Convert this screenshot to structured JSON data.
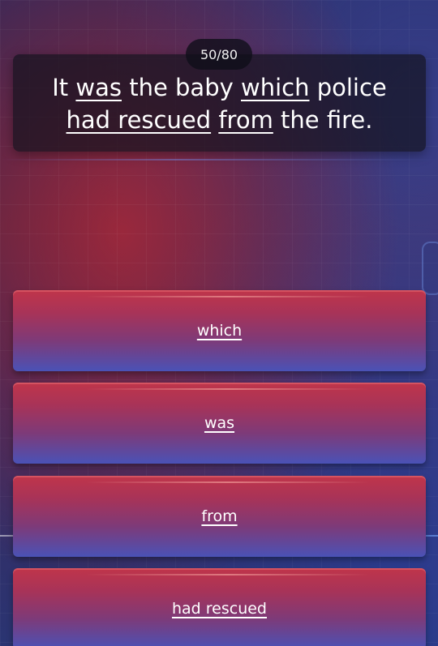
{
  "progress": {
    "label": "50/80",
    "current": 50,
    "total": 80
  },
  "question": {
    "segments": [
      {
        "text": "It ",
        "underlined": false
      },
      {
        "text": "was",
        "underlined": true
      },
      {
        "text": " the baby ",
        "underlined": false
      },
      {
        "text": "which",
        "underlined": true
      },
      {
        "text": " police",
        "underlined": false
      },
      {
        "text": "had rescued",
        "underlined": true
      },
      {
        "text": " ",
        "underlined": false
      },
      {
        "text": "from",
        "underlined": true
      },
      {
        "text": " the fire.",
        "underlined": false
      }
    ]
  },
  "options": [
    {
      "label": "which"
    },
    {
      "label": "was"
    },
    {
      "label": "from"
    },
    {
      "label": "had rescued"
    }
  ],
  "colors": {
    "option_top": "#c0354a",
    "option_bottom": "#4a52b6",
    "panel_bg": "#14121e",
    "text": "#ffffff"
  }
}
